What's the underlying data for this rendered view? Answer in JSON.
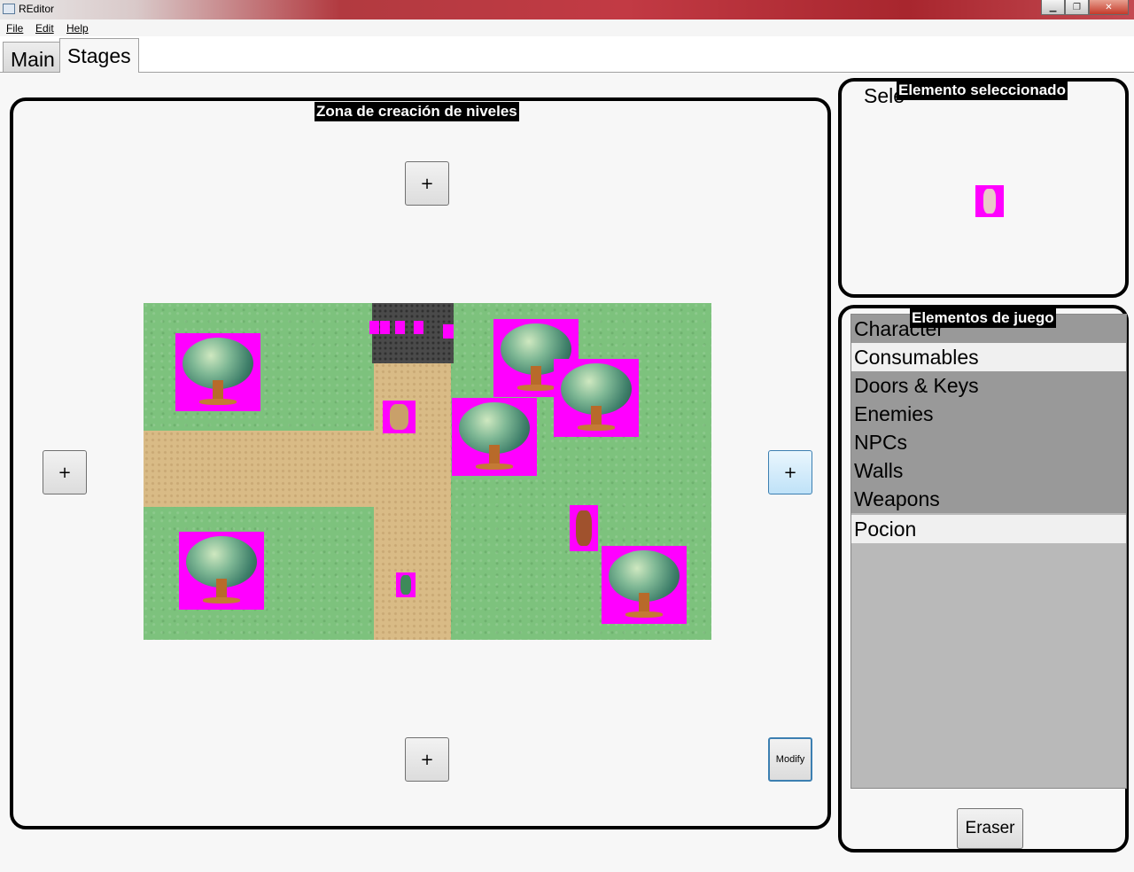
{
  "window": {
    "title": "REditor",
    "controls": {
      "minimize": "▁",
      "maximize": "❐",
      "close": "✕"
    }
  },
  "menu": {
    "file": "File",
    "edit": "Edit",
    "help": "Help"
  },
  "tabs": [
    {
      "label": "Main",
      "selected": false
    },
    {
      "label": "Stages",
      "selected": true
    }
  ],
  "stage_panel": {
    "title": "Zona de creación de niveles",
    "add_top": "+",
    "add_left": "+",
    "add_right": "+",
    "add_bottom": "+",
    "modify_label": "Modify"
  },
  "selected_panel": {
    "title": "Elemento seleccionado",
    "hidden_label": "Sele",
    "selected_sprite": "potion-sprite"
  },
  "elements_panel": {
    "title": "Elementos de juego",
    "categories": [
      "Character",
      "Consumables",
      "Doors & Keys",
      "Enemies",
      "NPCs",
      "Walls",
      "Weapons"
    ],
    "selected_category": "Consumables",
    "items": [
      "Pocion"
    ],
    "eraser_label": "Eraser"
  },
  "colors": {
    "sprite_background": "#ff00ff",
    "grass": "#7dc27d",
    "dirt_path": "#d9bb86",
    "stone": "#4a4a4a",
    "accent": "#3c7fb1"
  }
}
